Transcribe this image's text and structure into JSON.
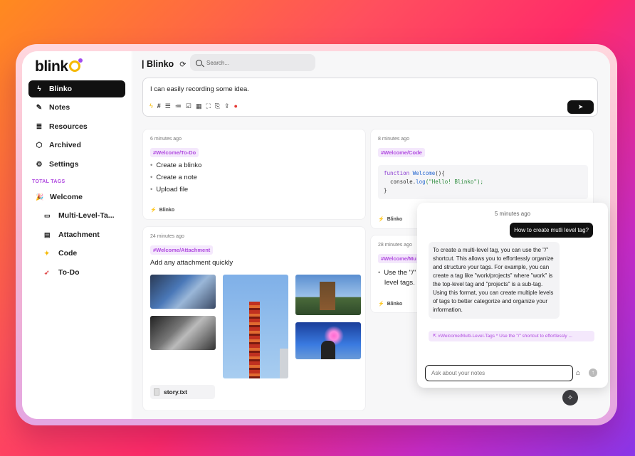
{
  "app": {
    "name": "blink",
    "title": "Blinko"
  },
  "sidebar": {
    "items": [
      {
        "label": "Blinko",
        "icon": "bolt-icon"
      },
      {
        "label": "Notes",
        "icon": "note-icon"
      },
      {
        "label": "Resources",
        "icon": "database-icon"
      },
      {
        "label": "Archived",
        "icon": "box-icon"
      },
      {
        "label": "Settings",
        "icon": "gear-icon"
      }
    ],
    "tags_title": "TOTAL TAGS",
    "tags": [
      {
        "label": "Welcome",
        "icon": "party-icon"
      },
      {
        "label": "Multi-Level-Ta...",
        "icon": "bandage-icon"
      },
      {
        "label": "Attachment",
        "icon": "cabinet-icon"
      },
      {
        "label": "Code",
        "icon": "sparkle-icon"
      },
      {
        "label": "To-Do",
        "icon": "rocket-icon"
      }
    ]
  },
  "search": {
    "placeholder": "Search..."
  },
  "editor": {
    "text": "I can easily recording some idea."
  },
  "cards": {
    "todo": {
      "time": "6 minutes ago",
      "tag": "#Welcome/To-Do",
      "items": [
        "Create a blinko",
        "Create a note",
        "Upload file"
      ],
      "footer": "Blinko"
    },
    "code": {
      "time": "8 minutes ago",
      "tag": "#Welcome/Code",
      "line1_kw": "function",
      "line1_fn": "Welcome",
      "line1_rest": "(){",
      "line2_obj": "console",
      "line2_fn": "log",
      "line2_str": "(\"Hello! Blinko\");",
      "line3": "}",
      "footer": "Blinko"
    },
    "attachment": {
      "time": "24 minutes ago",
      "tag": "#Welcome/Attachment",
      "text": "Add any attachment quickly",
      "file": "story.txt"
    },
    "multi": {
      "time": "28 minutes ago",
      "tag": "#Welcome/Mu",
      "line1": "Use the \"/\"",
      "line2": "level tags.",
      "footer": "Blinko"
    }
  },
  "chat": {
    "time": "5 minutes ago",
    "user_msg": "How to create mutli level tag?",
    "ai_msg": "To create a multi-level tag, you can use the \"/\" shortcut. This allows you to effortlessly organize and structure your tags. For example, you can create a tag like \"work/projects\" where \"work\" is the top-level tag and \"projects\" is a sub-tag. Using this format, you can create multiple levels of tags to better categorize and organize your information.",
    "reference": "#Welcome/Multi-Level-Tags * Use the \"/\" shortcut to effortlessly ...",
    "input_placeholder": "Ask about your notes"
  },
  "colors": {
    "accent": "#b04be0",
    "brand_yellow": "#f5b800"
  }
}
